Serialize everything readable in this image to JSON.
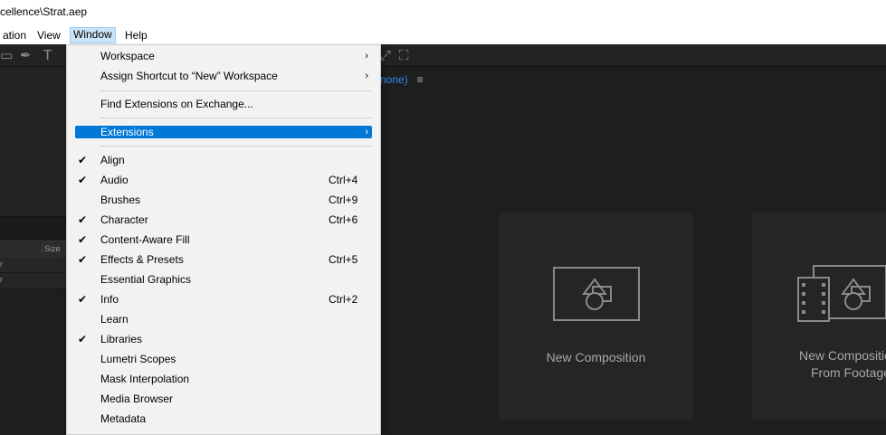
{
  "window": {
    "title": "cellence\\Strat.aep"
  },
  "menubar": {
    "items": [
      "ation",
      "View",
      "Window",
      "Help"
    ],
    "active": "Window"
  },
  "composition_panel": {
    "header_text": "none)",
    "menu_glyph": "≡"
  },
  "project_panel": {
    "column_size": "Size",
    "rows": [
      "r",
      "r"
    ]
  },
  "cards": {
    "new_composition": "New Composition",
    "new_from_footage_line1": "New Compositio",
    "new_from_footage_line2": "From Footage"
  },
  "window_menu": {
    "workspace": "Workspace",
    "assign_shortcut": "Assign Shortcut to “New” Workspace",
    "find_extensions": "Find Extensions on Exchange...",
    "extensions": "Extensions",
    "items": [
      {
        "label": "Align",
        "checked": true,
        "shortcut": ""
      },
      {
        "label": "Audio",
        "checked": true,
        "shortcut": "Ctrl+4"
      },
      {
        "label": "Brushes",
        "checked": false,
        "shortcut": "Ctrl+9"
      },
      {
        "label": "Character",
        "checked": true,
        "shortcut": "Ctrl+6"
      },
      {
        "label": "Content-Aware Fill",
        "checked": true,
        "shortcut": ""
      },
      {
        "label": "Effects & Presets",
        "checked": true,
        "shortcut": "Ctrl+5"
      },
      {
        "label": "Essential Graphics",
        "checked": false,
        "shortcut": ""
      },
      {
        "label": "Info",
        "checked": true,
        "shortcut": "Ctrl+2"
      },
      {
        "label": "Learn",
        "checked": false,
        "shortcut": ""
      },
      {
        "label": "Libraries",
        "checked": true,
        "shortcut": ""
      },
      {
        "label": "Lumetri Scopes",
        "checked": false,
        "shortcut": ""
      },
      {
        "label": "Mask Interpolation",
        "checked": false,
        "shortcut": ""
      },
      {
        "label": "Media Browser",
        "checked": false,
        "shortcut": ""
      },
      {
        "label": "Metadata",
        "checked": false,
        "shortcut": ""
      }
    ]
  },
  "glyphs": {
    "check": "✔",
    "submenu_arrow": "›"
  },
  "colors": {
    "highlight": "#0078d7",
    "menu_bg": "#f2f2f2",
    "link_blue": "#2d8ceb",
    "app_bg": "#1e1e1e"
  }
}
